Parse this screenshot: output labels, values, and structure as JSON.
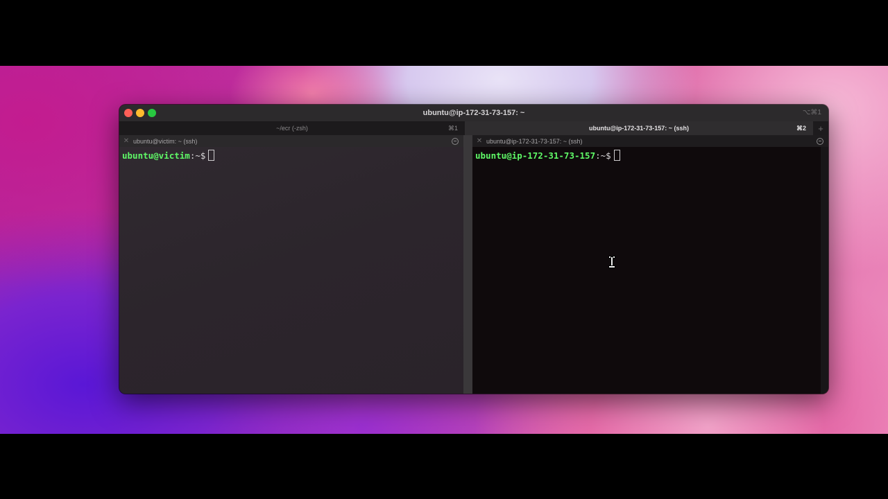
{
  "window": {
    "title": "ubuntu@ip-172-31-73-157: ~",
    "shortcut": "⌥⌘1"
  },
  "tabs": [
    {
      "label": "~/ecr (-zsh)",
      "shortcut": "⌘1",
      "active": false
    },
    {
      "label": "ubuntu@ip-172-31-73-157: ~ (ssh)",
      "shortcut": "⌘2",
      "active": true
    }
  ],
  "new_tab_label": "+",
  "panes": [
    {
      "header": "ubuntu@victim: ~ (ssh)",
      "prompt_user_host": "ubuntu@victim",
      "prompt_suffix": ":~$"
    },
    {
      "header": "ubuntu@ip-172-31-73-157: ~ (ssh)",
      "prompt_user_host": "ubuntu@ip-172-31-73-157",
      "prompt_suffix": ":~$"
    }
  ],
  "colors": {
    "prompt_green": "#5ff967",
    "traffic_close": "#fe5f57",
    "traffic_minimize": "#febc2e",
    "traffic_zoom": "#28c840"
  }
}
